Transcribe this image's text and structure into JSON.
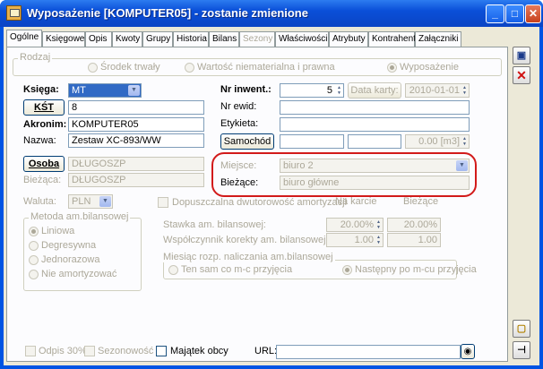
{
  "window": {
    "title": "Wyposażenie [KOMPUTER05] - zostanie zmienione",
    "minimize": "_",
    "maximize": "□",
    "close": "✕"
  },
  "tabs": [
    {
      "label": "Ogólne"
    },
    {
      "label": "Księgowe"
    },
    {
      "label": "Opis"
    },
    {
      "label": "Kwoty"
    },
    {
      "label": "Grupy"
    },
    {
      "label": "Historia"
    },
    {
      "label": "Bilans"
    },
    {
      "label": "Sezony"
    },
    {
      "label": "Właściwości"
    },
    {
      "label": "Atrybuty"
    },
    {
      "label": "Kontrahent"
    },
    {
      "label": "Załączniki"
    }
  ],
  "rodzaj": {
    "label": "Rodzaj",
    "options": [
      "Środek trwały",
      "Wartość niematerialna i prawna",
      "Wyposażenie"
    ],
    "selected": "Wyposażenie"
  },
  "fields": {
    "ksiega_label": "Księga:",
    "ksiega_value": "MT",
    "kst_button": "KŚT",
    "kst_value": "8",
    "akronim_label": "Akronim:",
    "akronim_value": "KOMPUTER05",
    "nazwa_label": "Nazwa:",
    "nazwa_value": "Zestaw XC-893/WW",
    "osoba_button": "Osoba",
    "osoba_value": "DŁUGOSZP",
    "biezaca_label": "Bieżąca:",
    "biezaca_value": "DŁUGOSZP",
    "nr_inwent_label": "Nr inwent.:",
    "nr_inwent_value": "5",
    "data_karty_button": "Data karty:",
    "data_karty_value": "2010-01-01",
    "nr_ewid_label": "Nr ewid:",
    "nr_ewid_value": "",
    "etykieta_label": "Etykieta:",
    "etykieta_value": "",
    "samochod_button": "Samochód",
    "samochod_value": "0.00 [m3]",
    "miejsce_label": "Miejsce:",
    "miejsce_value": "biuro 2",
    "biezace_label": "Bieżące:",
    "biezace_value": "biuro główne",
    "waluta_label": "Waluta:",
    "waluta_value": "PLN"
  },
  "metoda": {
    "label": "Metoda am.bilansowej",
    "options": [
      "Liniowa",
      "Degresywna",
      "Jednorazowa",
      "Nie amortyzować"
    ],
    "selected": "Liniowa"
  },
  "amortyzacja": {
    "dwutorowosc_label": "Dopuszczalna dwutorowość amortyzacji",
    "col_na_karcie": "Na karcie",
    "col_biezace": "Bieżące",
    "stawka_label": "Stawka am. bilansowej:",
    "stawka_karta": "20.00%",
    "stawka_biezaca": "20.00%",
    "wspolczynnik_label": "Współczynnik korekty am. bilansowej:",
    "wsp_karta": "1.00",
    "wsp_biezacy": "1.00"
  },
  "miesiac": {
    "label": "Miesiąc rozp. naliczania am.bilansowej",
    "options": [
      "Ten sam co m-c przyjęcia",
      "Następny po m-cu przyjęcia"
    ],
    "selected": "Następny po m-cu przyjęcia"
  },
  "bottom": {
    "odpis_label": "Odpis 30%",
    "sezonowosc_label": "Sezonowość",
    "majatek_label": "Majątek obcy",
    "url_label": "URL:",
    "url_value": ""
  },
  "side": {
    "save_icon": "floppy-disk",
    "cancel_icon": "red-x",
    "lock_icon": "padlock",
    "pin_icon": "pin"
  }
}
